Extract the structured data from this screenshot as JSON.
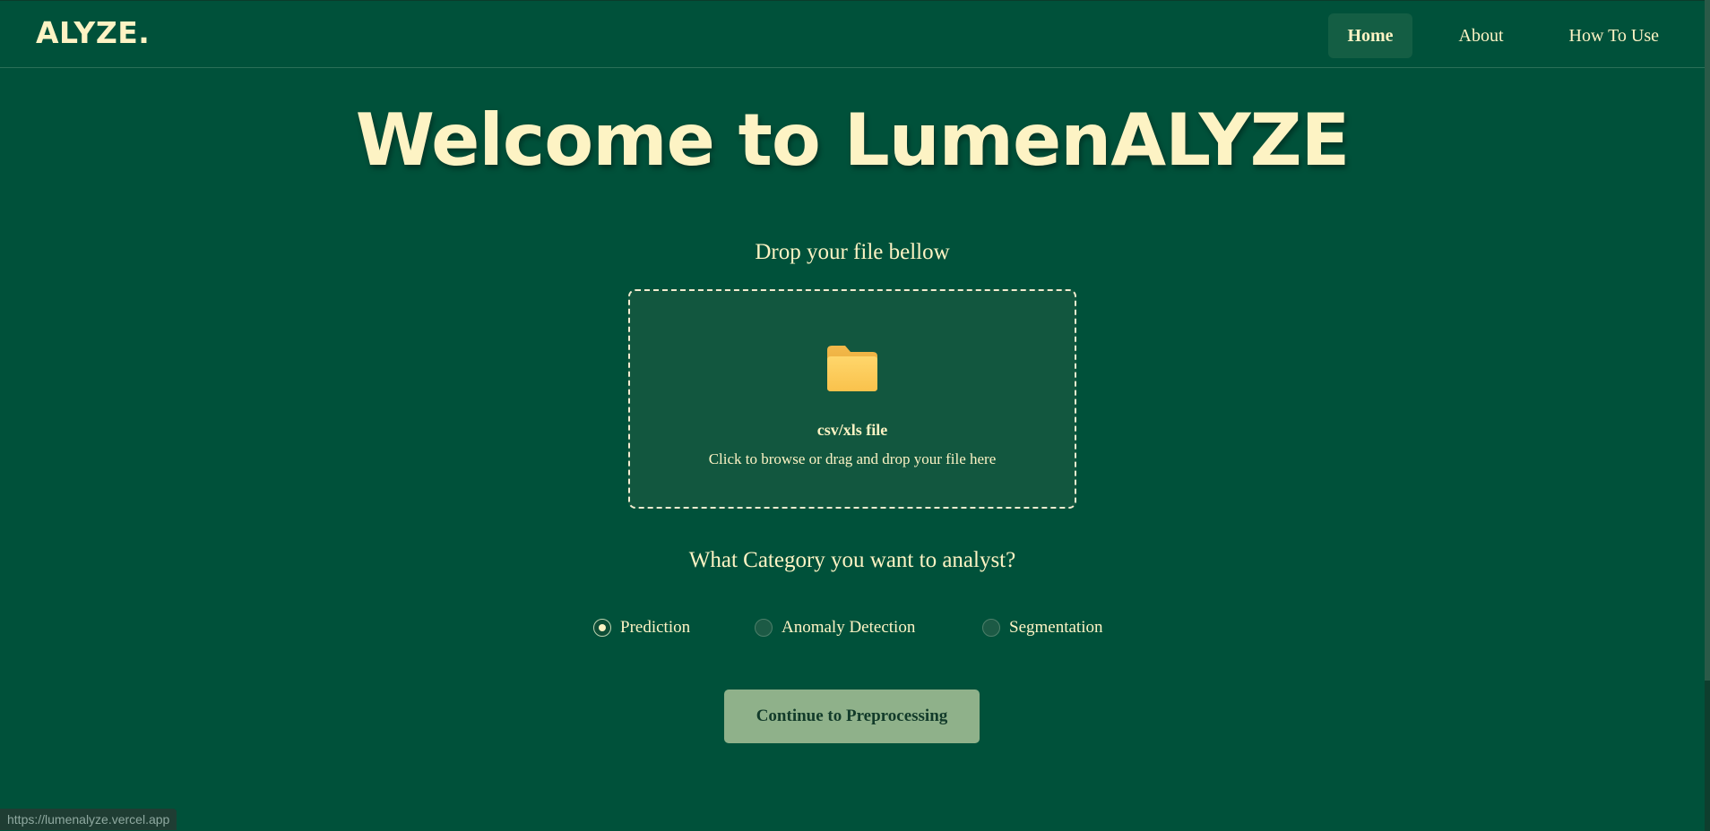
{
  "navbar": {
    "brand": "ALYZE.",
    "links": [
      {
        "label": "Home",
        "active": true
      },
      {
        "label": "About",
        "active": false
      },
      {
        "label": "How To Use",
        "active": false
      }
    ]
  },
  "hero": {
    "title": "Welcome to LumenALYZE"
  },
  "upload": {
    "label": "Drop your file bellow",
    "icon": "folder-icon",
    "file_type": "csv/xls file",
    "hint": "Click to browse or drag and drop your file here"
  },
  "category": {
    "question": "What Category you want to analyst?",
    "options": [
      {
        "label": "Prediction",
        "checked": true
      },
      {
        "label": "Anomaly Detection",
        "checked": false
      },
      {
        "label": "Segmentation",
        "checked": false
      }
    ]
  },
  "actions": {
    "continue_label": "Continue to Preprocessing"
  },
  "status_bar": {
    "url": "https://lumenalyze.vercel.app"
  },
  "colors": {
    "background": "#00513a",
    "text": "#fdf3c4",
    "button": "#8fb18a",
    "folder": "#f9c74f"
  }
}
